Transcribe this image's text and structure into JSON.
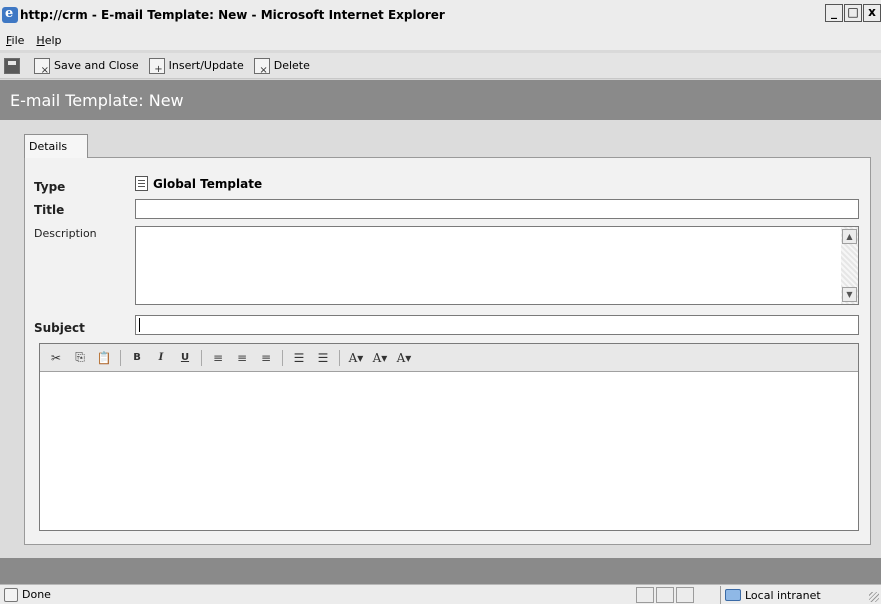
{
  "window": {
    "title": "http://crm - E-mail Template: New - Microsoft Internet Explorer",
    "min": "_",
    "max": "□",
    "close": "x"
  },
  "menu": {
    "items": [
      {
        "label": "File",
        "accel": "F",
        "rest": "ile"
      },
      {
        "label": "Help",
        "accel": "H",
        "rest": "elp"
      }
    ]
  },
  "toolbar": {
    "save_close": "Save and Close",
    "insert_update": "Insert/Update",
    "delete": "Delete"
  },
  "header": {
    "title": "E-mail Template: New"
  },
  "tabs": [
    {
      "label": "Details"
    }
  ],
  "form": {
    "type_label": "Type",
    "type_value": "Global Template",
    "title_label": "Title",
    "title_value": "",
    "description_label": "Description",
    "description_value": "",
    "subject_label": "Subject",
    "subject_value": ""
  },
  "editor": {
    "cut": "✂",
    "copy": "⎘",
    "paste": "📋",
    "bold": "B",
    "italic": "I",
    "underline": "U",
    "align_left": "≡",
    "align_center": "≡",
    "align_right": "≡",
    "numbered_list": "☰",
    "bulleted_list": "☰",
    "highlight": "A▾",
    "font_size": "A▾",
    "font_color": "A▾"
  },
  "status": {
    "text": "Done",
    "zone": "Local intranet"
  }
}
